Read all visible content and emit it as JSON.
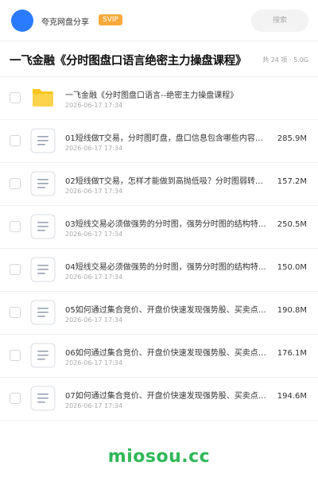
{
  "header": {
    "user_name": "夸克网盘分享",
    "badge": "SVIP",
    "search_placeholder": "搜索"
  },
  "title": {
    "text": "一飞金融《分时图盘口语言绝密主力操盘课程》",
    "meta": "共 24 项 · 5.0G"
  },
  "files": [
    {
      "name": "一飞金融《分时图盘口语言--绝密主力操盘课程》",
      "date": "2026-06-17 17:34",
      "size": "",
      "icon": "folder-icon"
    },
    {
      "name": "01短线做T交易，分时图盯盘，盘口信息包含哪些内容…",
      "date": "2026-06-17 17:34",
      "size": "285.9M",
      "icon": "document-icon"
    },
    {
      "name": "02短线做T交易，怎样才能做到高抛低吸？分时图弱转…",
      "date": "2026-06-17 17:34",
      "size": "157.2M",
      "icon": "document-icon"
    },
    {
      "name": "03短线交易必须做强势的分时图，强势分时图的结构特…",
      "date": "2026-06-17 17:34",
      "size": "250.5M",
      "icon": "document-icon"
    },
    {
      "name": "04短线交易必须做强势的分时图，强势分时图的结构特…",
      "date": "2026-06-17 17:34",
      "size": "150.0M",
      "icon": "document-icon"
    },
    {
      "name": "05如何通过集合竞价、开盘价快速发现强势股、买卖点…",
      "date": "2026-06-17 17:34",
      "size": "190.8M",
      "icon": "document-icon"
    },
    {
      "name": "06如何通过集合竞价、开盘价快速发现强势股、买卖点…",
      "date": "2026-06-17 17:34",
      "size": "176.1M",
      "icon": "document-icon"
    },
    {
      "name": "07如何通过集合竞价、开盘价快速发现强势股、买卖点…",
      "date": "2026-06-17 17:34",
      "size": "194.6M",
      "icon": "document-icon"
    }
  ],
  "watermark": "miosou.cc",
  "colors": {
    "avatar": "#2b7bff",
    "badge": "#f6a93a",
    "folder": "#f9c41e",
    "watermark": "#2fb857"
  }
}
